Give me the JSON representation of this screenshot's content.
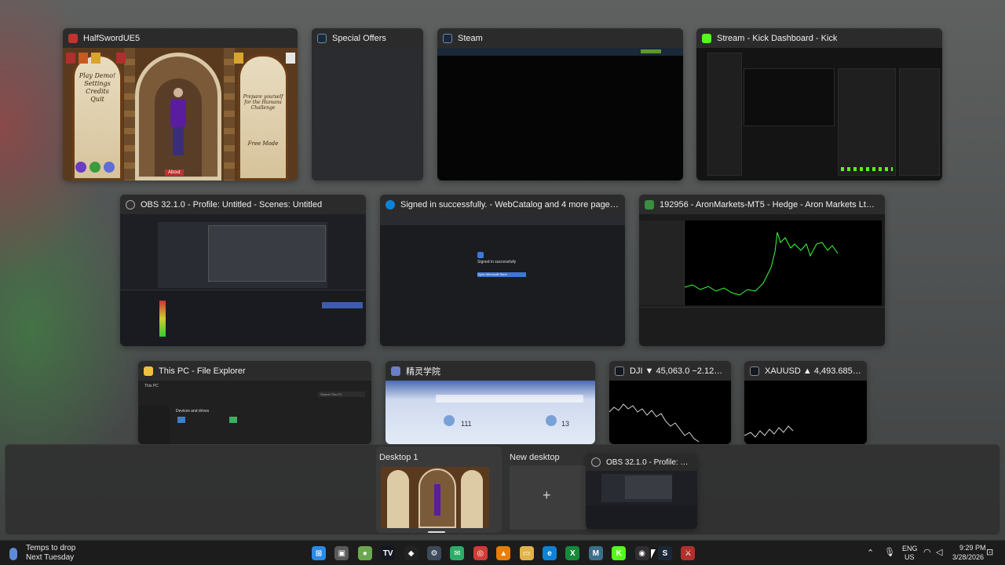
{
  "windows": [
    {
      "title": "HalfSwordUE5",
      "app_icon": "halfsword-icon",
      "icon_color": "#c2332e"
    },
    {
      "title": "Special Offers",
      "app_icon": "steam-icon",
      "icon_color": "#1b2838"
    },
    {
      "title": "Steam",
      "app_icon": "steam-icon",
      "icon_color": "#1b2838"
    },
    {
      "title": "Stream - Kick Dashboard - Kick",
      "app_icon": "kick-icon",
      "icon_color": "#53fc18"
    },
    {
      "title": "OBS 32.1.0 - Profile: Untitled - Scenes: Untitled",
      "app_icon": "obs-icon",
      "icon_color": "#302e31"
    },
    {
      "title": "Signed in successfully. - WebCatalog and 4 more pages - Profile 1 - Microsof...",
      "app_icon": "edge-icon",
      "icon_color": "#0a84d8"
    },
    {
      "title": "192956 - AronMarkets-MT5 - Hedge - Aron Markets Ltd - [XAUUSD,M5]",
      "app_icon": "mt5-icon",
      "icon_color": "#3c8d40"
    },
    {
      "title": "This PC - File Explorer",
      "app_icon": "explorer-icon",
      "icon_color": "#f0c040"
    },
    {
      "title": "精灵学院",
      "app_icon": "app-icon",
      "icon_color": "#6b7fc8"
    },
    {
      "title": "DJI ▼ 45,063.0 −2.12% / Unnamed",
      "app_icon": "tradingview-icon",
      "icon_color": "#131722"
    },
    {
      "title": "XAUUSD ▲ 4,493.685 +2.64% / U...",
      "app_icon": "tradingview-icon",
      "icon_color": "#131722"
    }
  ],
  "game_menu": [
    "Play Demo!",
    "Settings",
    "Credits",
    "Quit"
  ],
  "game_side_text": "Prepare yourself for the Humans Challenge",
  "game_side_button": "Free Mode",
  "game_center_button": "About",
  "explorer_texts": {
    "tab": "This PC",
    "search": "Search This PC",
    "section": "Devices and drives"
  },
  "chinese_texts": {
    "stat1": "111",
    "stat2": "13"
  },
  "edge_texts": {
    "heading": "Signed in successfully",
    "button": "Open Microsoft Store"
  },
  "desktops": [
    {
      "label": "Desktop 1"
    },
    {
      "label": "New desktop",
      "symbol": "+"
    }
  ],
  "drag_window": {
    "title": "OBS 32.1.0 - Profile: Untitle..."
  },
  "taskbar": {
    "weather_title": "Temps to drop",
    "weather_sub": "Next Tuesday",
    "language": "ENG",
    "region": "US",
    "time": "9:29 PM",
    "date": "3/28/2026",
    "apps": [
      {
        "name": "start-icon",
        "color": "#2b8ae6",
        "glyph": "⊞"
      },
      {
        "name": "task-view-icon",
        "color": "#5a5a5a",
        "glyph": "▣"
      },
      {
        "name": "app-icon",
        "color": "#6aa84f",
        "glyph": "●"
      },
      {
        "name": "tradingview-icon",
        "color": "#131722",
        "glyph": "TV"
      },
      {
        "name": "binance-icon",
        "color": "#222",
        "glyph": "◆"
      },
      {
        "name": "settings-icon",
        "color": "#3d4a5c",
        "glyph": "⚙"
      },
      {
        "name": "wechat-icon",
        "color": "#2aae67",
        "glyph": "✉"
      },
      {
        "name": "app-red-icon",
        "color": "#d23a35",
        "glyph": "◎"
      },
      {
        "name": "vlc-icon",
        "color": "#e87e04",
        "glyph": "▲"
      },
      {
        "name": "folder-icon",
        "color": "#e0b34a",
        "glyph": "▭"
      },
      {
        "name": "edge-icon",
        "color": "#0a84d8",
        "glyph": "e"
      },
      {
        "name": "xbox-icon",
        "color": "#178a3a",
        "glyph": "X"
      },
      {
        "name": "mt5-icon",
        "color": "#3c6f8c",
        "glyph": "M"
      },
      {
        "name": "kick-icon",
        "color": "#53fc18",
        "glyph": "K"
      },
      {
        "name": "obs-icon",
        "color": "#302e31",
        "glyph": "◉"
      },
      {
        "name": "steam-icon",
        "color": "#1b2838",
        "glyph": "S"
      },
      {
        "name": "halfsword-icon",
        "color": "#b0302b",
        "glyph": "⚔"
      }
    ]
  },
  "colors": {
    "accent": "#4cc2ff",
    "chart_green": "#3cff3c"
  }
}
